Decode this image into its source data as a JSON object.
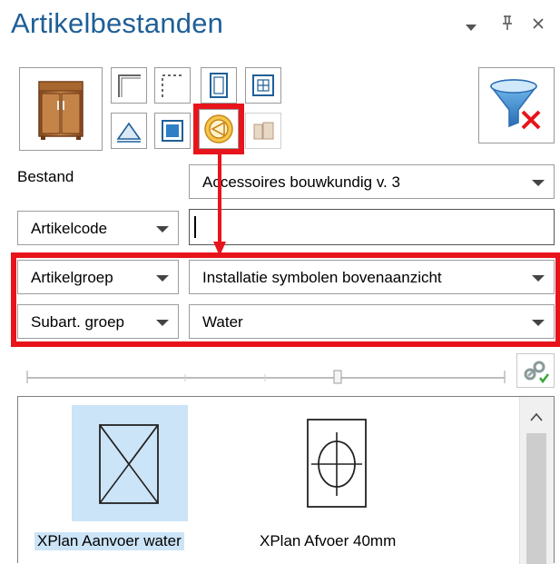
{
  "panel": {
    "title": "Artikelbestanden",
    "controls": {
      "dropdown": "▾",
      "pin": "⮑",
      "close": "×"
    }
  },
  "filter": {
    "bestand_label": "Bestand",
    "bestand_value": "Accessoires bouwkundig v. 3",
    "field1_label": "Artikelcode",
    "field1_value": "",
    "field2_label": "Artikelgroep",
    "field2_value": "Installatie symbolen bovenaanzicht",
    "field3_label": "Subart. groep",
    "field3_value": "Water"
  },
  "colors": {
    "title": "#1f5f97",
    "highlight": "#e8141b",
    "selection": "#cce4f7"
  },
  "items": [
    {
      "caption": "XPlan Aanvoer water",
      "icon": "valve-symbol-icon",
      "selected": true
    },
    {
      "caption": "XPlan Afvoer 40mm",
      "icon": "drain-symbol-icon",
      "selected": false
    }
  ]
}
